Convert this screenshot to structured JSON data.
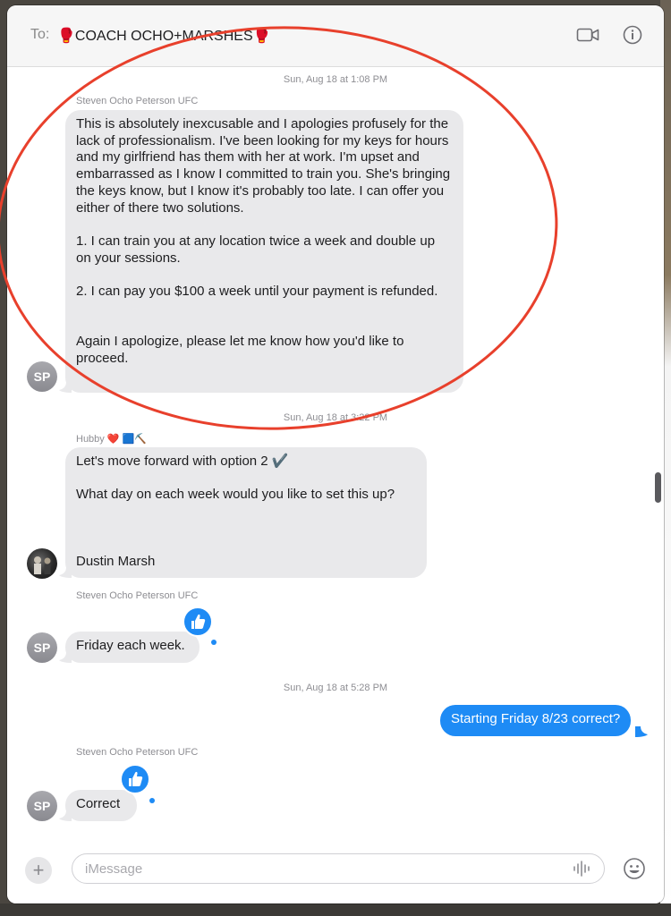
{
  "header": {
    "to_label": "To:",
    "recipient": "🥊COACH OCHO+MARSHES🥊"
  },
  "messages": {
    "ts1": {
      "day": "Sun, Aug 18 at",
      "time": "1:08 PM"
    },
    "sender1": "Steven Ocho Peterson UFC",
    "bubble1": "This is absolutely inexcusable and I apologies profusely for the lack of professionalism. I've been looking for my keys for hours and my girlfriend has them with her at work. I'm upset and embarrassed as I know I committed to train you. She's bringing the keys know, but I know it's probably too late. I can offer you either of there two solutions.\n\n1. I can train you at any location twice a week and double up on your sessions.\n\n2. I can pay you $100 a week until your payment is refunded.\n\n\nAgain I apologize, please let me know how you'd like to proceed.",
    "avatar1": "SP",
    "ts2": {
      "day": "Sun, Aug 18 at",
      "time": "3:22 PM"
    },
    "sender2": "Hubby ❤️ 🟦⛏️",
    "bubble2": "Let's move forward with option 2 ✔️\n\nWhat day on each week would you like to set this up?\n\n\n\nDustin Marsh",
    "sender3": "Steven Ocho Peterson UFC",
    "bubble3": "Friday each week.",
    "avatar3": "SP",
    "ts3": {
      "day": "Sun, Aug 18 at",
      "time": "5:28 PM"
    },
    "bubble4": "Starting Friday 8/23 correct?",
    "sender5": "Steven Ocho Peterson UFC",
    "bubble5": "Correct",
    "avatar5": "SP"
  },
  "composer": {
    "placeholder": "iMessage",
    "plus_label": "+"
  },
  "icons": [
    "video-icon",
    "info-icon",
    "thumbs-up-icon",
    "audio-waveform-icon",
    "emoji-icon",
    "plus-icon"
  ],
  "colors": {
    "outgoing_bubble": "#1e8bf5",
    "incoming_bubble": "#e9e9eb",
    "annotation_circle": "#e8402c"
  }
}
